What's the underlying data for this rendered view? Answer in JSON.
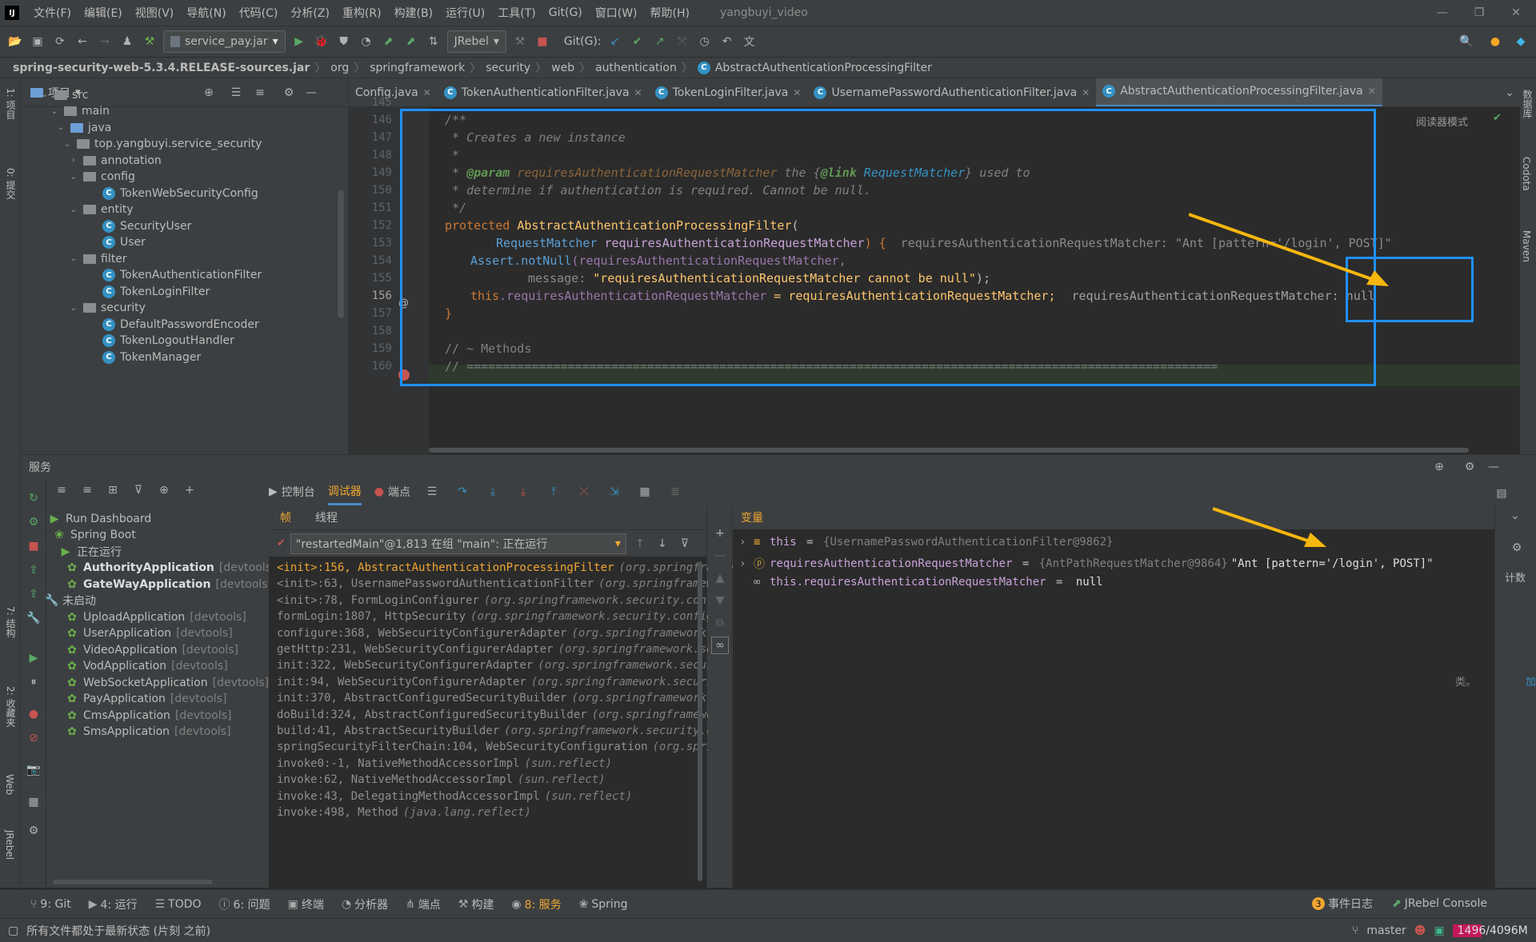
{
  "menu": {
    "items": [
      "文件(F)",
      "编辑(E)",
      "视图(V)",
      "导航(N)",
      "代码(C)",
      "分析(Z)",
      "重构(R)",
      "构建(B)",
      "运行(U)",
      "工具(T)",
      "Git(G)",
      "窗口(W)",
      "帮助(H)"
    ],
    "project_name": "yangbuyi_video"
  },
  "toolbar": {
    "run_config": "service_pay.jar",
    "jrebel_label": "JRebel",
    "git_label": "Git(G):"
  },
  "breadcrumb": [
    "spring-security-web-5.3.4.RELEASE-sources.jar",
    "org",
    "springframework",
    "security",
    "web",
    "authentication",
    "AbstractAuthenticationProcessingFilter"
  ],
  "left_strip": {
    "project": "1: 项目",
    "commit": "0: 提交",
    "structure": "7: 结构",
    "favorites": "2: 收藏夹",
    "web": "Web",
    "jrebel": "JRebel"
  },
  "right_strip": {
    "database": "数据库",
    "codota": "Codota",
    "maven": "Maven"
  },
  "project_panel": {
    "title": "项目",
    "tree": [
      {
        "label": "src",
        "type": "folder"
      },
      {
        "label": "main",
        "type": "folder"
      },
      {
        "label": "java",
        "type": "folder-blue"
      },
      {
        "label": "top.yangbuyi.service_security",
        "type": "package"
      },
      {
        "label": "annotation",
        "type": "package"
      },
      {
        "label": "config",
        "type": "package"
      },
      {
        "label": "TokenWebSecurityConfig",
        "type": "class"
      },
      {
        "label": "entity",
        "type": "package"
      },
      {
        "label": "SecurityUser",
        "type": "class"
      },
      {
        "label": "User",
        "type": "class"
      },
      {
        "label": "filter",
        "type": "package"
      },
      {
        "label": "TokenAuthenticationFilter",
        "type": "class"
      },
      {
        "label": "TokenLoginFilter",
        "type": "class"
      },
      {
        "label": "security",
        "type": "package"
      },
      {
        "label": "DefaultPasswordEncoder",
        "type": "class"
      },
      {
        "label": "TokenLogoutHandler",
        "type": "class"
      },
      {
        "label": "TokenManager",
        "type": "class"
      }
    ]
  },
  "editor": {
    "tabs": [
      {
        "label": "Config.java",
        "active": false
      },
      {
        "label": "TokenAuthenticationFilter.java",
        "active": false
      },
      {
        "label": "TokenLoginFilter.java",
        "active": false
      },
      {
        "label": "UsernamePasswordAuthenticationFilter.java",
        "active": false
      },
      {
        "label": "AbstractAuthenticationProcessingFilter.java",
        "active": true
      }
    ],
    "reader_mode": "阅读器模式",
    "line_numbers": [
      "145",
      "146",
      "147",
      "148",
      "149",
      "150",
      "151",
      "152",
      "153",
      "154",
      "155",
      "156",
      "157",
      "158",
      "159",
      "160"
    ],
    "code": {
      "l146": "/**",
      "l147": " * Creates a new instance",
      "l148": " *",
      "l149_a": " * ",
      "l149_param": "@param",
      "l149_b": " requiresAuthenticationRequestMatcher",
      "l149_c": " the {",
      "l149_link": "@link",
      "l149_d": " RequestMatcher",
      "l149_e": "} used to",
      "l150": " * determine if authentication is required. Cannot be null.",
      "l151": " */",
      "l152_kw": "protected ",
      "l152_name": "AbstractAuthenticationProcessingFilter",
      "l152_p": "(",
      "l153_type": "RequestMatcher ",
      "l153_param": "requiresAuthenticationRequestMatcher",
      "l153_end": ") {",
      "l153_hint": "requiresAuthenticationRequestMatcher: \"Ant [pattern='/login', POST]\"",
      "l154_a": "Assert.",
      "l154_m": "notNull",
      "l154_b": "(requiresAuthenticationRequestMatcher,",
      "l155_label": "message: ",
      "l155_str": "\"requiresAuthenticationRequestMatcher cannot be null\"",
      "l155_end": ");",
      "l156_this": "this",
      "l156_field": ".requiresAuthenticationRequestMatcher",
      "l156_rest": " = requiresAuthenticationRequestMatcher;",
      "l156_hint": "requiresAuthenticationRequestMatcher: null",
      "l157": "}",
      "l159": "// ~ Methods",
      "l160": "// ========================================================================================================"
    }
  },
  "services": {
    "title": "服务",
    "tabs": {
      "console": "控制台",
      "debugger": "调试器",
      "breakpoints": "端点"
    },
    "tree": {
      "run_dashboard": "Run Dashboard",
      "spring_boot": "Spring Boot",
      "running": "正在运行",
      "running_apps": [
        {
          "name": "AuthorityApplication",
          "tag": "[devtools]"
        },
        {
          "name": "GateWayApplication",
          "tag": "[devtools]"
        }
      ],
      "not_started": "未启动",
      "stopped_apps": [
        {
          "name": "UploadApplication",
          "tag": "[devtools]"
        },
        {
          "name": "UserApplication",
          "tag": "[devtools]"
        },
        {
          "name": "VideoApplication",
          "tag": "[devtools]"
        },
        {
          "name": "VodApplication",
          "tag": "[devtools]"
        },
        {
          "name": "WebSocketApplication",
          "tag": "[devtools]"
        },
        {
          "name": "PayApplication",
          "tag": "[devtools]"
        },
        {
          "name": "CmsApplication",
          "tag": "[devtools]"
        },
        {
          "name": "SmsApplication",
          "tag": "[devtools]"
        }
      ]
    },
    "frames": {
      "tab_frames": "帧",
      "tab_threads": "线程",
      "thread": "\"restartedMain\"@1,813 在组 \"main\": 正在运行",
      "list": [
        {
          "method": "<init>:156, AbstractAuthenticationProcessingFilter",
          "pkg": "(org.springframework",
          "current": true
        },
        {
          "method": "<init>:63, UsernamePasswordAuthenticationFilter",
          "pkg": "(org.springframewo"
        },
        {
          "method": "<init>:78, FormLoginConfigurer",
          "pkg": "(org.springframework.security.confi"
        },
        {
          "method": "formLogin:1807, HttpSecurity",
          "pkg": "(org.springframework.security.config."
        },
        {
          "method": "configure:368, WebSecurityConfigurerAdapter",
          "pkg": "(org.springframework.s"
        },
        {
          "method": "getHttp:231, WebSecurityConfigurerAdapter",
          "pkg": "(org.springframework.sec"
        },
        {
          "method": "init:322, WebSecurityConfigurerAdapter",
          "pkg": "(org.springframework.securi"
        },
        {
          "method": "init:94, WebSecurityConfigurerAdapter",
          "pkg": "(org.springframework.securit"
        },
        {
          "method": "init:370, AbstractConfiguredSecurityBuilder",
          "pkg": "(org.springframework.s"
        },
        {
          "method": "doBuild:324, AbstractConfiguredSecurityBuilder",
          "pkg": "(org.springframewor"
        },
        {
          "method": "build:41, AbstractSecurityBuilder",
          "pkg": "(org.springframework.security.co"
        },
        {
          "method": "springSecurityFilterChain:104, WebSecurityConfiguration",
          "pkg": "(org.sprin"
        },
        {
          "method": "invoke0:-1, NativeMethodAccessorImpl",
          "pkg": "(sun.reflect)"
        },
        {
          "method": "invoke:62, NativeMethodAccessorImpl",
          "pkg": "(sun.reflect)"
        },
        {
          "method": "invoke:43, DelegatingMethodAccessorImpl",
          "pkg": "(sun.reflect)"
        },
        {
          "method": "invoke:498, Method",
          "pkg": "(java.lang.reflect)"
        }
      ]
    },
    "variables": {
      "title": "变量",
      "rows": [
        {
          "name": "this",
          "eq": " = ",
          "value": "{UsernamePasswordAuthenticationFilter@9862}",
          "extra": ""
        },
        {
          "name": "requiresAuthenticationRequestMatcher",
          "eq": " = ",
          "value": "{AntPathRequestMatcher@9864}",
          "extra": " \"Ant [pattern='/login', POST]\""
        },
        {
          "name": "this.requiresAuthenticationRequestMatcher",
          "eq": " = ",
          "value": "",
          "extra": "null"
        }
      ],
      "right_label": "计数",
      "side_text": "类。",
      "side_link": "加"
    }
  },
  "tool_windows": [
    {
      "label": "9: Git",
      "icon": "git-icon"
    },
    {
      "label": "4: 运行",
      "icon": "run-icon"
    },
    {
      "label": "TODO",
      "icon": "todo-icon"
    },
    {
      "label": "6: 问题",
      "icon": "problems-icon"
    },
    {
      "label": "终端",
      "icon": "terminal-icon"
    },
    {
      "label": "分析器",
      "icon": "profiler-icon"
    },
    {
      "label": "端点",
      "icon": "endpoints-icon"
    },
    {
      "label": "构建",
      "icon": "build-icon"
    },
    {
      "label": "8: 服务",
      "icon": "services-icon",
      "active": true
    },
    {
      "label": "Spring",
      "icon": "spring-icon"
    }
  ],
  "tool_windows_right": {
    "event_log": "事件日志",
    "event_count": "3",
    "jrebel_console": "JRebel Console"
  },
  "status": {
    "message": "所有文件都处于最新状态 (片刻 之前)",
    "branch": "master",
    "memory": "1496/4096M"
  },
  "colors": {
    "accent": "#4a88c7",
    "highlight_box": "#1e90ff",
    "annotation_arrow": "#f5b70f"
  }
}
